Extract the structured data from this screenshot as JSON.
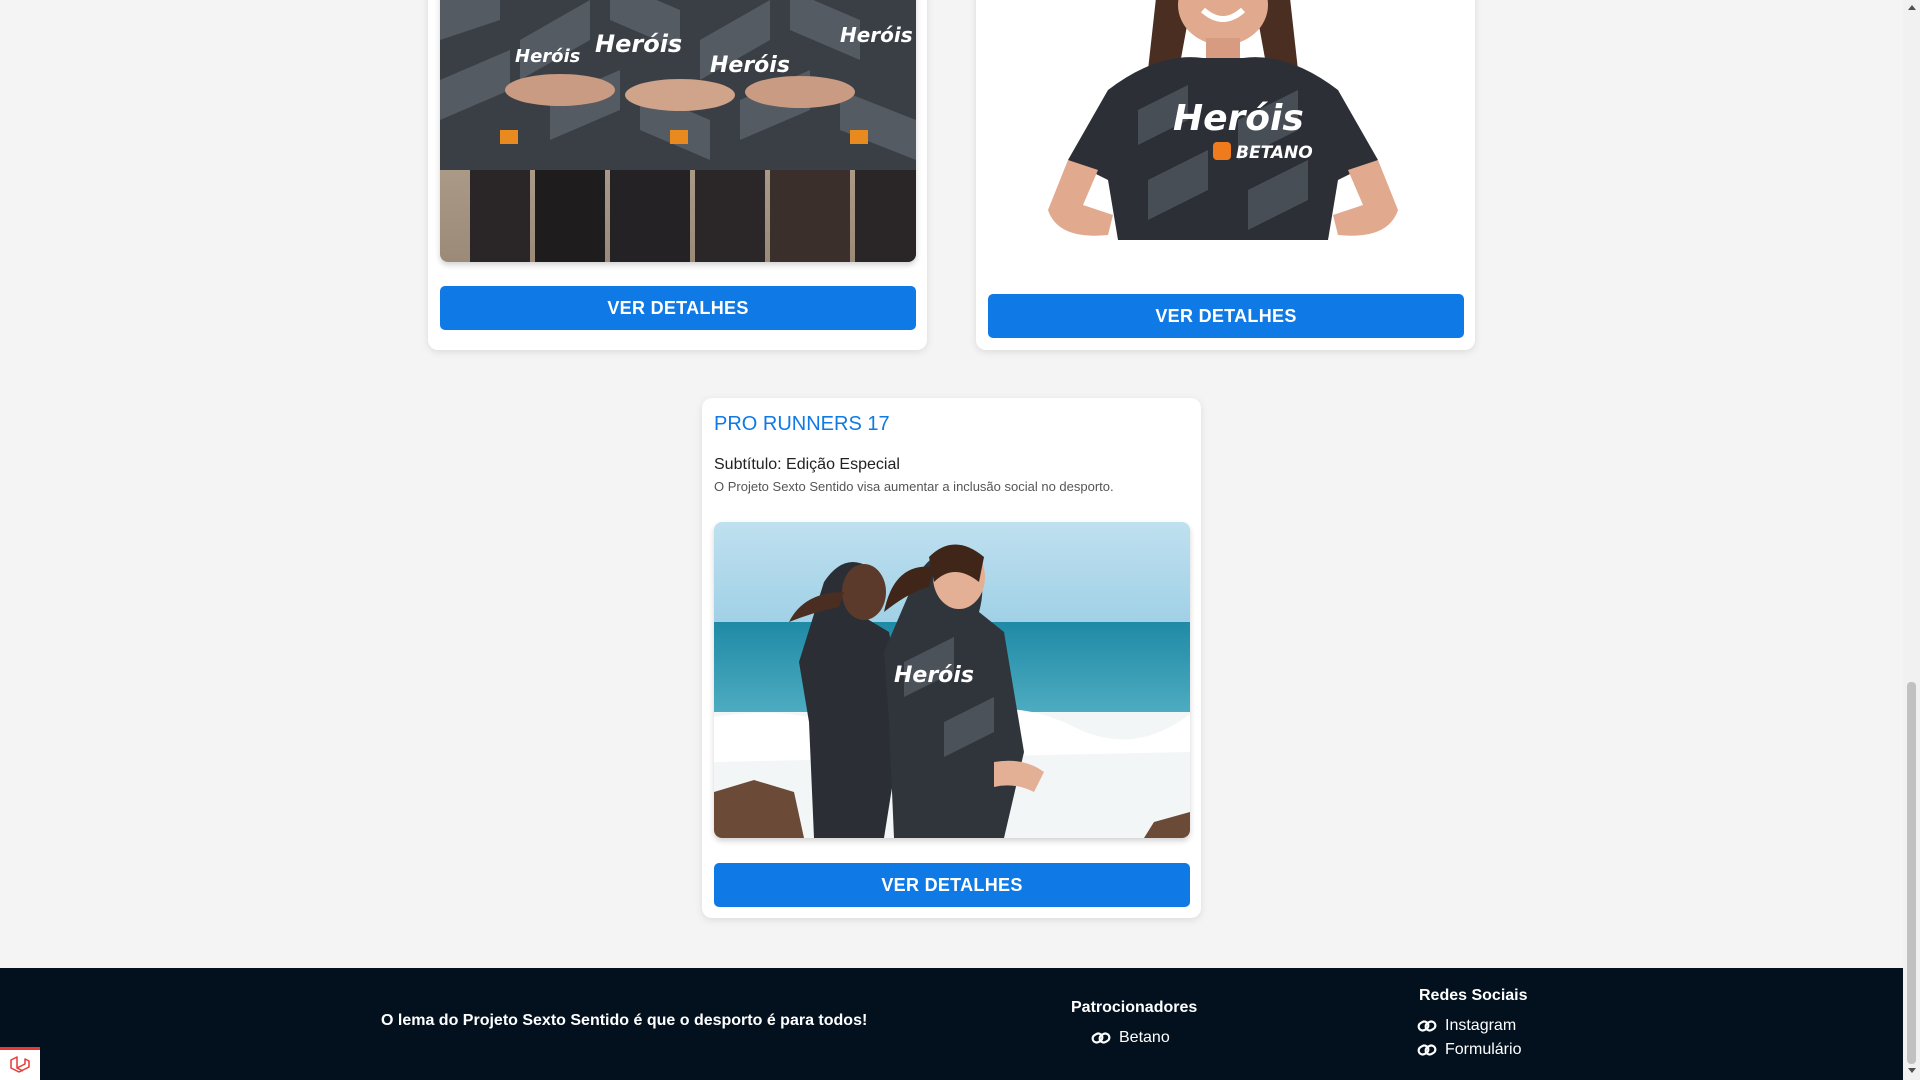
{
  "cards": [
    {
      "button_label": "VER DETALHES"
    },
    {
      "button_label": "VER DETALHES"
    },
    {
      "title": "PRO RUNNERS 17",
      "subtitle": "Subtítulo: Edição Especial",
      "description": "O Projeto Sexto Sentido visa aumentar a inclusão social no desporto.",
      "button_label": "VER DETALHES"
    }
  ],
  "jersey_print": {
    "brand": "Heróis",
    "sponsor": "BETANO"
  },
  "footer": {
    "motto": "O lema do Projeto Sexto Sentido é que o desporto é para todos!",
    "sponsors_heading": "Patrocionadores",
    "sponsors": [
      "Betano"
    ],
    "social_heading": "Redes Sociais",
    "social_links": [
      "Instagram",
      "Formulário"
    ]
  },
  "colors": {
    "accent": "#0f7ae5",
    "footer_bg": "#03111f",
    "page_bg": "#f4f4f4"
  },
  "icons": {
    "link": "link-icon",
    "corner": "laravel-icon"
  }
}
